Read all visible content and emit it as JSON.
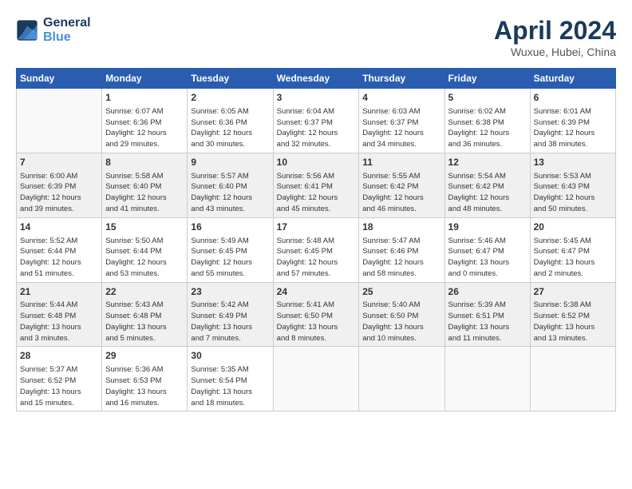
{
  "header": {
    "logo_line1": "General",
    "logo_line2": "Blue",
    "title": "April 2024",
    "location": "Wuxue, Hubei, China"
  },
  "columns": [
    "Sunday",
    "Monday",
    "Tuesday",
    "Wednesday",
    "Thursday",
    "Friday",
    "Saturday"
  ],
  "weeks": [
    [
      {
        "num": "",
        "info": ""
      },
      {
        "num": "1",
        "info": "Sunrise: 6:07 AM\nSunset: 6:36 PM\nDaylight: 12 hours\nand 29 minutes."
      },
      {
        "num": "2",
        "info": "Sunrise: 6:05 AM\nSunset: 6:36 PM\nDaylight: 12 hours\nand 30 minutes."
      },
      {
        "num": "3",
        "info": "Sunrise: 6:04 AM\nSunset: 6:37 PM\nDaylight: 12 hours\nand 32 minutes."
      },
      {
        "num": "4",
        "info": "Sunrise: 6:03 AM\nSunset: 6:37 PM\nDaylight: 12 hours\nand 34 minutes."
      },
      {
        "num": "5",
        "info": "Sunrise: 6:02 AM\nSunset: 6:38 PM\nDaylight: 12 hours\nand 36 minutes."
      },
      {
        "num": "6",
        "info": "Sunrise: 6:01 AM\nSunset: 6:39 PM\nDaylight: 12 hours\nand 38 minutes."
      }
    ],
    [
      {
        "num": "7",
        "info": "Sunrise: 6:00 AM\nSunset: 6:39 PM\nDaylight: 12 hours\nand 39 minutes."
      },
      {
        "num": "8",
        "info": "Sunrise: 5:58 AM\nSunset: 6:40 PM\nDaylight: 12 hours\nand 41 minutes."
      },
      {
        "num": "9",
        "info": "Sunrise: 5:57 AM\nSunset: 6:40 PM\nDaylight: 12 hours\nand 43 minutes."
      },
      {
        "num": "10",
        "info": "Sunrise: 5:56 AM\nSunset: 6:41 PM\nDaylight: 12 hours\nand 45 minutes."
      },
      {
        "num": "11",
        "info": "Sunrise: 5:55 AM\nSunset: 6:42 PM\nDaylight: 12 hours\nand 46 minutes."
      },
      {
        "num": "12",
        "info": "Sunrise: 5:54 AM\nSunset: 6:42 PM\nDaylight: 12 hours\nand 48 minutes."
      },
      {
        "num": "13",
        "info": "Sunrise: 5:53 AM\nSunset: 6:43 PM\nDaylight: 12 hours\nand 50 minutes."
      }
    ],
    [
      {
        "num": "14",
        "info": "Sunrise: 5:52 AM\nSunset: 6:44 PM\nDaylight: 12 hours\nand 51 minutes."
      },
      {
        "num": "15",
        "info": "Sunrise: 5:50 AM\nSunset: 6:44 PM\nDaylight: 12 hours\nand 53 minutes."
      },
      {
        "num": "16",
        "info": "Sunrise: 5:49 AM\nSunset: 6:45 PM\nDaylight: 12 hours\nand 55 minutes."
      },
      {
        "num": "17",
        "info": "Sunrise: 5:48 AM\nSunset: 6:45 PM\nDaylight: 12 hours\nand 57 minutes."
      },
      {
        "num": "18",
        "info": "Sunrise: 5:47 AM\nSunset: 6:46 PM\nDaylight: 12 hours\nand 58 minutes."
      },
      {
        "num": "19",
        "info": "Sunrise: 5:46 AM\nSunset: 6:47 PM\nDaylight: 13 hours\nand 0 minutes."
      },
      {
        "num": "20",
        "info": "Sunrise: 5:45 AM\nSunset: 6:47 PM\nDaylight: 13 hours\nand 2 minutes."
      }
    ],
    [
      {
        "num": "21",
        "info": "Sunrise: 5:44 AM\nSunset: 6:48 PM\nDaylight: 13 hours\nand 3 minutes."
      },
      {
        "num": "22",
        "info": "Sunrise: 5:43 AM\nSunset: 6:48 PM\nDaylight: 13 hours\nand 5 minutes."
      },
      {
        "num": "23",
        "info": "Sunrise: 5:42 AM\nSunset: 6:49 PM\nDaylight: 13 hours\nand 7 minutes."
      },
      {
        "num": "24",
        "info": "Sunrise: 5:41 AM\nSunset: 6:50 PM\nDaylight: 13 hours\nand 8 minutes."
      },
      {
        "num": "25",
        "info": "Sunrise: 5:40 AM\nSunset: 6:50 PM\nDaylight: 13 hours\nand 10 minutes."
      },
      {
        "num": "26",
        "info": "Sunrise: 5:39 AM\nSunset: 6:51 PM\nDaylight: 13 hours\nand 11 minutes."
      },
      {
        "num": "27",
        "info": "Sunrise: 5:38 AM\nSunset: 6:52 PM\nDaylight: 13 hours\nand 13 minutes."
      }
    ],
    [
      {
        "num": "28",
        "info": "Sunrise: 5:37 AM\nSunset: 6:52 PM\nDaylight: 13 hours\nand 15 minutes."
      },
      {
        "num": "29",
        "info": "Sunrise: 5:36 AM\nSunset: 6:53 PM\nDaylight: 13 hours\nand 16 minutes."
      },
      {
        "num": "30",
        "info": "Sunrise: 5:35 AM\nSunset: 6:54 PM\nDaylight: 13 hours\nand 18 minutes."
      },
      {
        "num": "",
        "info": ""
      },
      {
        "num": "",
        "info": ""
      },
      {
        "num": "",
        "info": ""
      },
      {
        "num": "",
        "info": ""
      }
    ]
  ]
}
